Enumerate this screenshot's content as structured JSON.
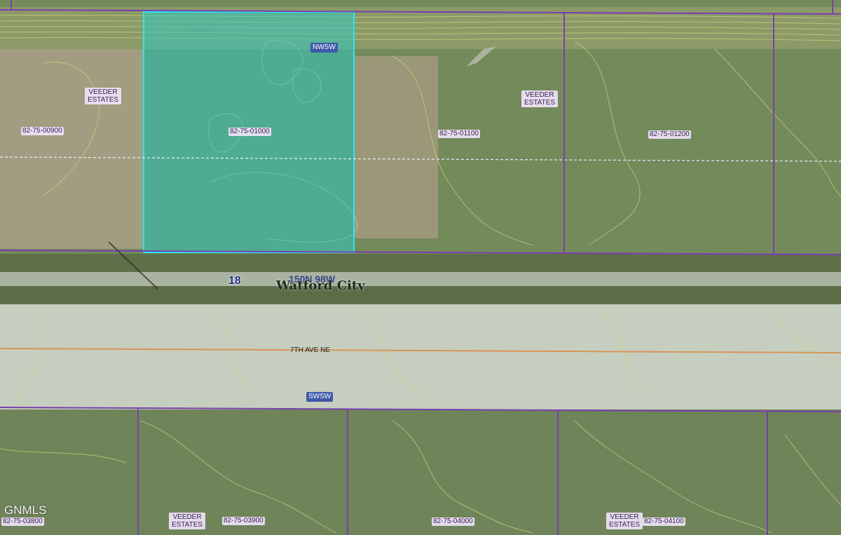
{
  "map": {
    "watermark": "GNMLS",
    "section_number": "18",
    "township_range": "150N 98W",
    "city_name": "Watford City",
    "street_name": "7TH AVE NE",
    "aliquot_labels": [
      "NWSW",
      "SWSW"
    ],
    "subdivision_name": "VEEDER ESTATES",
    "parcels_top_row": [
      "82-75-00900",
      "82-75-01000",
      "82-75-01100",
      "82-75-01200"
    ],
    "parcels_bottom_row": [
      "82-75-03800",
      "82-75-03900",
      "82-75-04000",
      "82-75-04100"
    ],
    "selected_parcel": "82-75-01000",
    "colors": {
      "parcel_line": "#7a3fb0",
      "selected_outline": "#28e8f0",
      "selected_fill": "#30c8c0",
      "section_line_dashed": "#e8f0ff",
      "street_centerline": "#d8945a",
      "contour": "#c8d27a",
      "field_green": "#6f8558",
      "pavement": "#c6cfbf"
    }
  }
}
